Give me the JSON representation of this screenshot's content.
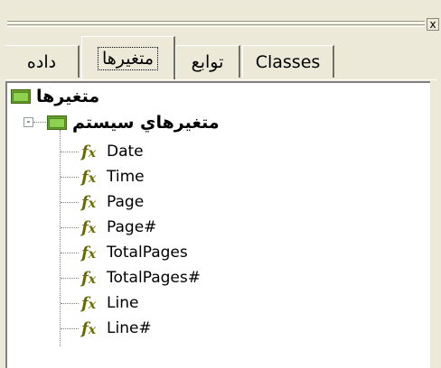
{
  "tabs": [
    {
      "label": "داده",
      "active": false
    },
    {
      "label": "متغیرها",
      "active": true
    },
    {
      "label": "توابع",
      "active": false
    },
    {
      "label": "Classes",
      "active": false
    }
  ],
  "close_label": "x",
  "tree": {
    "root_label": "متغیرها",
    "system_label": "متغیرهاي سيستم",
    "expander_symbol": "-",
    "items": [
      "Date",
      "Time",
      "Page",
      "Page#",
      "TotalPages",
      "TotalPages#",
      "Line",
      "Line#"
    ],
    "item_icon": "fx-function-icon"
  },
  "colors": {
    "panel_bg": "#ece9d8",
    "folder_green": "#8fd14f",
    "fx_color": "#6b6b00"
  }
}
